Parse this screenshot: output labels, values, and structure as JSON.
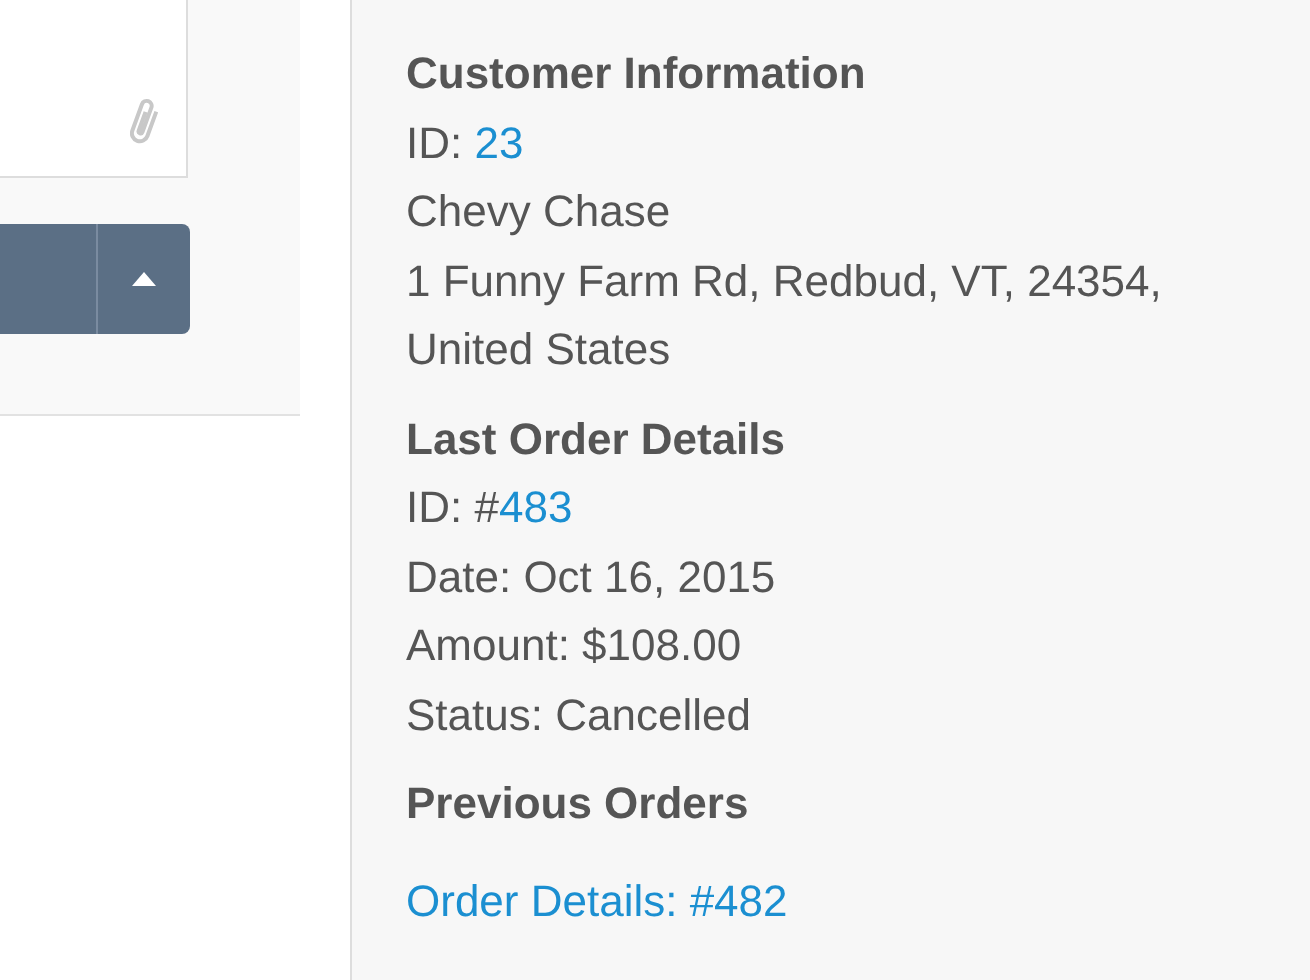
{
  "sections": [
    {
      "title": "Customer Information",
      "lines": [
        {
          "label": "ID: ",
          "link": "23"
        },
        {
          "text": "Chevy Chase"
        },
        {
          "text": "1 Funny Farm Rd, Redbud, VT, 24354, United States"
        }
      ]
    },
    {
      "title": "Last Order Details",
      "lines": [
        {
          "label": "ID: #",
          "link": "483"
        },
        {
          "text": "Date: Oct 16, 2015"
        },
        {
          "text": "Amount: $108.00"
        },
        {
          "text": "Status: Cancelled"
        }
      ]
    },
    {
      "title": "Previous Orders",
      "lines": [
        {
          "link": "Order Details: #482"
        }
      ]
    }
  ]
}
